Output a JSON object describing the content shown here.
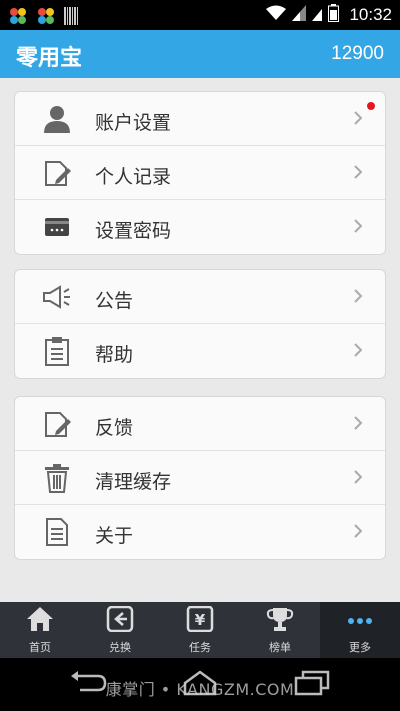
{
  "status_bar": {
    "time": "10:32",
    "icons": [
      "app-flower-icon",
      "app-flower-icon",
      "barcode-icon",
      "wifi-icon",
      "signal-icon",
      "sim-icon",
      "battery-icon"
    ]
  },
  "app_bar": {
    "title": "零用宝",
    "balance": "12900"
  },
  "groups": [
    {
      "items": [
        {
          "label": "账户设置",
          "icon": "person-icon",
          "badge": true
        },
        {
          "label": "个人记录",
          "icon": "edit-document-icon",
          "badge": false
        },
        {
          "label": "设置密码",
          "icon": "password-card-icon",
          "badge": false
        }
      ]
    },
    {
      "items": [
        {
          "label": "公告",
          "icon": "megaphone-icon",
          "badge": false
        },
        {
          "label": "帮助",
          "icon": "clipboard-icon",
          "badge": false
        }
      ]
    },
    {
      "items": [
        {
          "label": "反馈",
          "icon": "feedback-edit-icon",
          "badge": false
        },
        {
          "label": "清理缓存",
          "icon": "trash-icon",
          "badge": false
        },
        {
          "label": "关于",
          "icon": "document-icon",
          "badge": false
        }
      ]
    }
  ],
  "bottom_nav": {
    "items": [
      {
        "label": "首页",
        "icon": "home-icon",
        "active": false
      },
      {
        "label": "兑换",
        "icon": "exchange-icon",
        "active": false
      },
      {
        "label": "任务",
        "icon": "yen-task-icon",
        "active": false
      },
      {
        "label": "榜单",
        "icon": "trophy-icon",
        "active": false
      },
      {
        "label": "更多",
        "icon": "more-dots-icon",
        "active": true
      }
    ]
  },
  "watermark": "康掌门 • KANGZM.COM",
  "colors": {
    "app_bar": "#33a6e6",
    "badge": "#e8141e",
    "bottom_nav": "#2f3238",
    "page_bg": "#e9e9e9"
  }
}
